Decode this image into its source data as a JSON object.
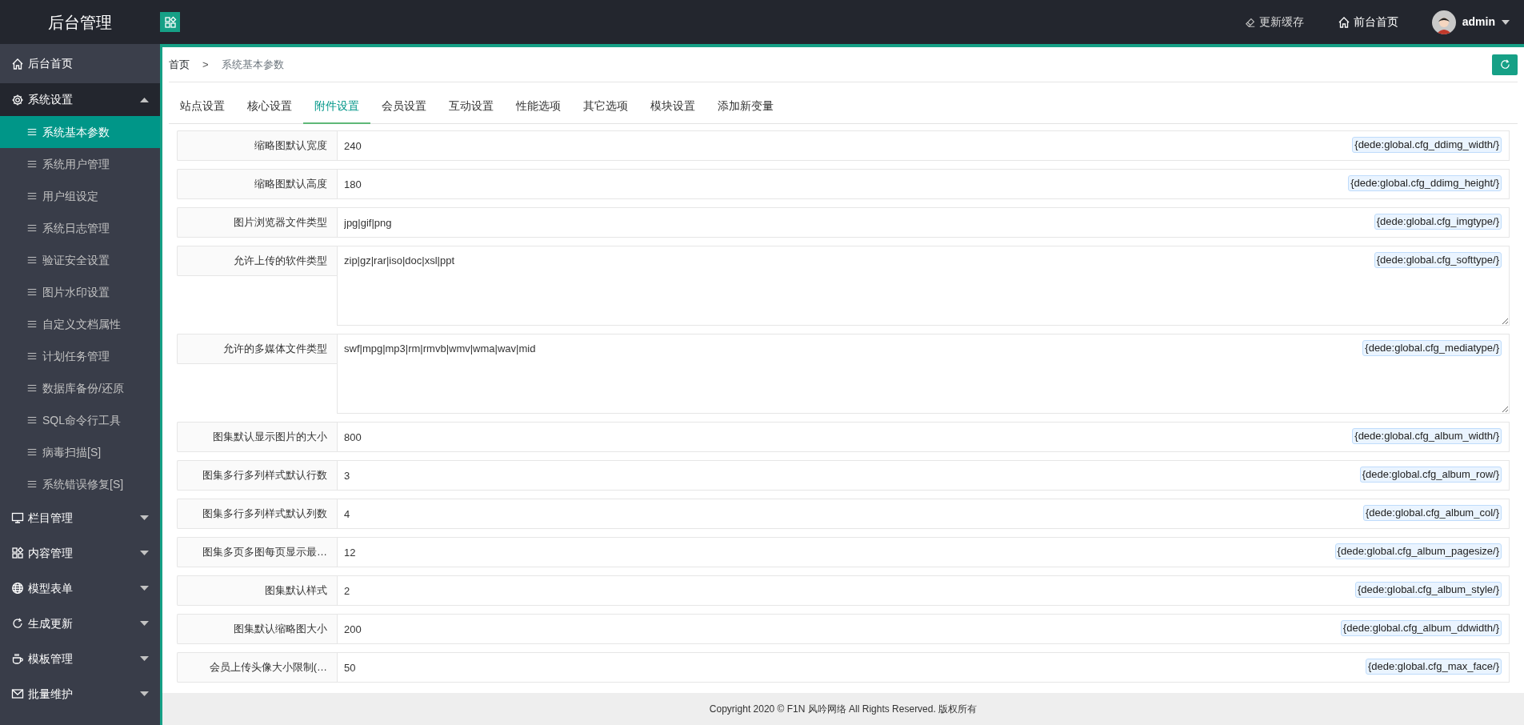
{
  "topbar": {
    "logo": "后台管理",
    "actions": [
      {
        "label": "更新缓存"
      },
      {
        "label": "前台首页"
      }
    ],
    "user": "admin"
  },
  "sidebar": {
    "items": [
      {
        "label": "后台首页"
      },
      {
        "label": "系统设置",
        "expanded": true,
        "children": [
          {
            "label": "系统基本参数",
            "selected": true
          },
          {
            "label": "系统用户管理",
            "selected": false
          },
          {
            "label": "用户组设定",
            "selected": false
          },
          {
            "label": "系统日志管理",
            "selected": false
          },
          {
            "label": "验证安全设置",
            "selected": false
          },
          {
            "label": "图片水印设置",
            "selected": false
          },
          {
            "label": "自定义文档属性",
            "selected": false
          },
          {
            "label": "计划任务管理",
            "selected": false
          },
          {
            "label": "数据库备份/还原",
            "selected": false
          },
          {
            "label": "SQL命令行工具",
            "selected": false
          },
          {
            "label": "病毒扫描[S]",
            "selected": false
          },
          {
            "label": "系统错误修复[S]",
            "selected": false
          }
        ]
      },
      {
        "label": "栏目管理",
        "expanded": false
      },
      {
        "label": "内容管理",
        "expanded": false
      },
      {
        "label": "模型表单",
        "expanded": false
      },
      {
        "label": "生成更新",
        "expanded": false
      },
      {
        "label": "模板管理",
        "expanded": false
      },
      {
        "label": "批量维护",
        "expanded": false
      }
    ]
  },
  "breadcrumb": {
    "items": [
      "首页",
      "系统基本参数"
    ],
    "separator": ">"
  },
  "tabs": [
    {
      "label": "站点设置",
      "selected": false
    },
    {
      "label": "核心设置",
      "selected": false
    },
    {
      "label": "附件设置",
      "selected": true
    },
    {
      "label": "会员设置",
      "selected": false
    },
    {
      "label": "互动设置",
      "selected": false
    },
    {
      "label": "性能选项",
      "selected": false
    },
    {
      "label": "其它选项",
      "selected": false
    },
    {
      "label": "模块设置",
      "selected": false
    },
    {
      "label": "添加新变量",
      "selected": false
    }
  ],
  "fields": [
    {
      "kind": "input",
      "label": "缩略图默认宽度",
      "value": "240",
      "tag": "{dede:global.cfg_ddimg_width/}"
    },
    {
      "kind": "input",
      "label": "缩略图默认高度",
      "value": "180",
      "tag": "{dede:global.cfg_ddimg_height/}"
    },
    {
      "kind": "input",
      "label": "图片浏览器文件类型",
      "value": "jpg|gif|png",
      "tag": "{dede:global.cfg_imgtype/}"
    },
    {
      "kind": "textarea",
      "label": "允许上传的软件类型",
      "value": "zip|gz|rar|iso|doc|xsl|ppt",
      "tag": "{dede:global.cfg_softtype/}"
    },
    {
      "kind": "textarea",
      "label": "允许的多媒体文件类型",
      "value": "swf|mpg|mp3|rm|rmvb|wmv|wma|wav|mid",
      "tag": "{dede:global.cfg_mediatype/}"
    },
    {
      "kind": "input",
      "label": "图集默认显示图片的大小",
      "value": "800",
      "tag": "{dede:global.cfg_album_width/}"
    },
    {
      "kind": "input",
      "label": "图集多行多列样式默认行数",
      "value": "3",
      "tag": "{dede:global.cfg_album_row/}"
    },
    {
      "kind": "input",
      "label": "图集多行多列样式默认列数",
      "value": "4",
      "tag": "{dede:global.cfg_album_col/}"
    },
    {
      "kind": "input",
      "label": "图集多页多图每页显示最…",
      "value": "12",
      "tag": "{dede:global.cfg_album_pagesize/}"
    },
    {
      "kind": "input",
      "label": "图集默认样式",
      "value": "2",
      "tag": "{dede:global.cfg_album_style/}"
    },
    {
      "kind": "input",
      "label": "图集默认缩略图大小",
      "value": "200",
      "tag": "{dede:global.cfg_album_ddwidth/}"
    },
    {
      "kind": "input",
      "label": "会员上传头像大小限制(…",
      "value": "50",
      "tag": "{dede:global.cfg_max_face/}"
    }
  ],
  "footer": "Copyright 2020 © F1N 风吟网络 All Rights Reserved. 版权所有"
}
